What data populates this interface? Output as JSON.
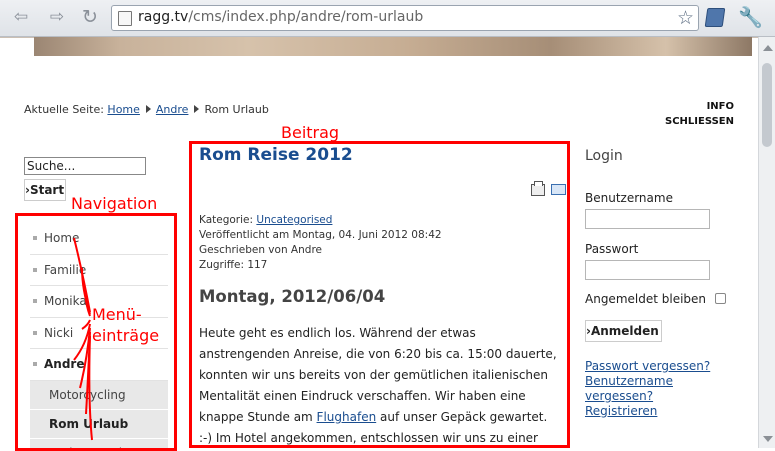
{
  "browser": {
    "url_host": "ragg.tv",
    "url_path": "/cms/index.php/andre/rom-urlaub",
    "back_icon": "back-arrow-icon",
    "forward_icon": "forward-arrow-icon",
    "reload_icon": "reload-icon"
  },
  "breadcrumb": {
    "prefix": "Aktuelle Seite:",
    "home": "Home",
    "andre": "Andre",
    "current": "Rom Urlaub"
  },
  "toplinks": {
    "info": "INFO",
    "close": "SCHLIESSEN"
  },
  "search": {
    "value": "Suche...",
    "button": "Start"
  },
  "nav": {
    "items": [
      "Home",
      "Familie",
      "Monika",
      "Nicki",
      "Andre"
    ],
    "subitems": [
      "Motorcycling",
      "Rom Urlaub",
      "Andres Music"
    ]
  },
  "article": {
    "title": "Rom Reise 2012",
    "category_label": "Kategorie:",
    "category": "Uncategorised",
    "published": "Veröffentlicht am Montag, 04. Juni 2012 08:42",
    "author": "Geschrieben von Andre",
    "hits": "Zugriffe: 117",
    "heading": "Montag, 2012/06/04",
    "body_1": "Heute geht es endlich los. Während der etwas anstrengenden Anreise, die von 6:20 bis ca. 15:00 dauerte, konnten wir uns bereits von der gemütlichen italienischen Mentalität einen Eindruck verschaffen. Wir haben eine knappe Stunde am ",
    "body_link": "Flughafen",
    "body_2": " auf unser Gepäck gewartet. :-) Im Hotel angekommen, entschlossen wir uns zu einer kleinen"
  },
  "login": {
    "title": "Login",
    "username_label": "Benutzername",
    "password_label": "Passwort",
    "remember_label": "Angemeldet bleiben",
    "button": "Anmelden",
    "forgot_password": "Passwort vergessen?",
    "forgot_username_1": "Benutzername",
    "forgot_username_2": "vergessen?",
    "register": "Registrieren"
  },
  "annotations": {
    "beitrag": "Beitrag",
    "navigation": "Navigation",
    "menu_1": "Menü-",
    "menu_2": "einträge"
  },
  "colors": {
    "annotation": "#ff0000",
    "link": "#1a4d8f"
  }
}
